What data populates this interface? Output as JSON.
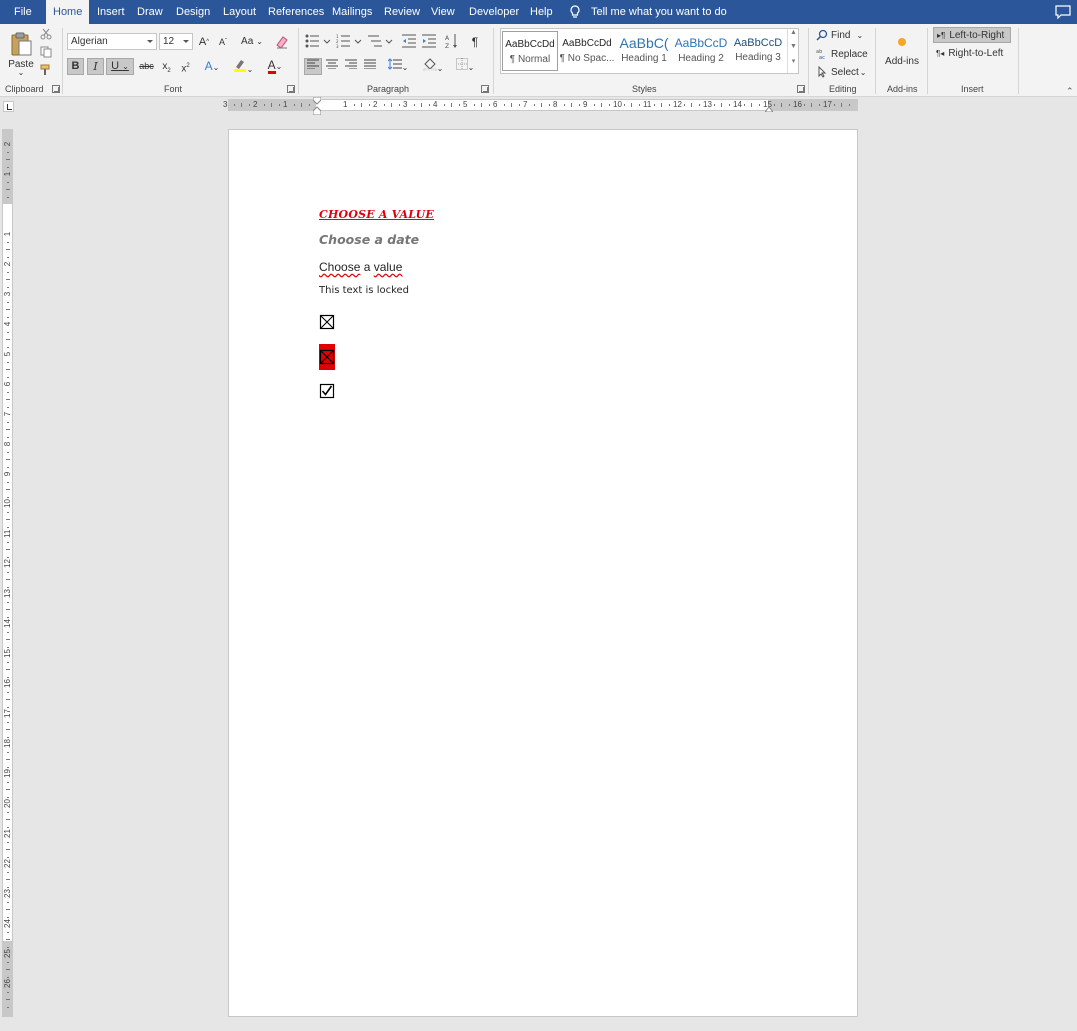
{
  "tabs": [
    {
      "label": "File",
      "active": false
    },
    {
      "label": "Home",
      "active": true
    },
    {
      "label": "Insert",
      "active": false
    },
    {
      "label": "Draw",
      "active": false
    },
    {
      "label": "Design",
      "active": false
    },
    {
      "label": "Layout",
      "active": false
    },
    {
      "label": "References",
      "active": false
    },
    {
      "label": "Mailings",
      "active": false
    },
    {
      "label": "Review",
      "active": false
    },
    {
      "label": "View",
      "active": false
    },
    {
      "label": "Developer",
      "active": false
    },
    {
      "label": "Help",
      "active": false
    }
  ],
  "tellme": {
    "icon": "lightbulb-icon",
    "label": "Tell me what you want to do"
  },
  "ribbon": {
    "clipboard": {
      "group_label": "Clipboard",
      "paste_label": "Paste"
    },
    "font": {
      "group_label": "Font",
      "font_name": "Algerian",
      "font_size": "12",
      "case_label": "Aa"
    },
    "paragraph": {
      "group_label": "Paragraph"
    },
    "styles": {
      "group_label": "Styles",
      "items": [
        {
          "preview": "AaBbCcDd",
          "name": "¶ Normal",
          "selected": true
        },
        {
          "preview": "AaBbCcDd",
          "name": "¶ No Spac...",
          "selected": false
        },
        {
          "preview": "AaBbC(",
          "name": "Heading 1",
          "selected": false
        },
        {
          "preview": "AaBbCcD",
          "name": "Heading 2",
          "selected": false
        },
        {
          "preview": "AaBbCcD",
          "name": "Heading 3",
          "selected": false
        }
      ]
    },
    "editing": {
      "group_label": "Editing",
      "find_label": "Find",
      "replace_label": "Replace",
      "select_label": "Select"
    },
    "addins": {
      "group_label": "Add-ins",
      "button_label": "Add-ins"
    },
    "insert": {
      "group_label": "Insert",
      "ltr_label": "Left-to-Right",
      "rtl_label": "Right-to-Left"
    }
  },
  "ruler": {
    "horizontal_numbers": [
      "3",
      "2",
      "1",
      "1",
      "2",
      "3",
      "4",
      "5",
      "6",
      "7",
      "8",
      "9",
      "10",
      "11",
      "12",
      "13",
      "14",
      "15",
      "16",
      "17"
    ],
    "vertical_numbers": [
      "2",
      "1",
      "1",
      "2",
      "3",
      "4",
      "5",
      "6",
      "7",
      "8",
      "9",
      "10",
      "11",
      "12",
      "13",
      "14",
      "15",
      "16",
      "17",
      "18",
      "19",
      "20",
      "21",
      "22",
      "23",
      "24",
      "25",
      "26",
      "27"
    ]
  },
  "document": {
    "title_control": "Choose a Value",
    "date_control": "Choose a date",
    "value_control_word1": "Choose",
    "value_control_mid": " a ",
    "value_control_word2": "value",
    "locked_text": "This text is locked",
    "checkboxes": [
      {
        "state": "crossed",
        "highlight": false
      },
      {
        "state": "crossed",
        "highlight": true,
        "highlight_color": "#e00000"
      },
      {
        "state": "checked",
        "highlight": false
      }
    ]
  },
  "colors": {
    "tab_bar": "#2b579a",
    "title_red": "#e0000b",
    "font_color_underline": "#e00000",
    "highlight_yellow": "#ffff00"
  }
}
